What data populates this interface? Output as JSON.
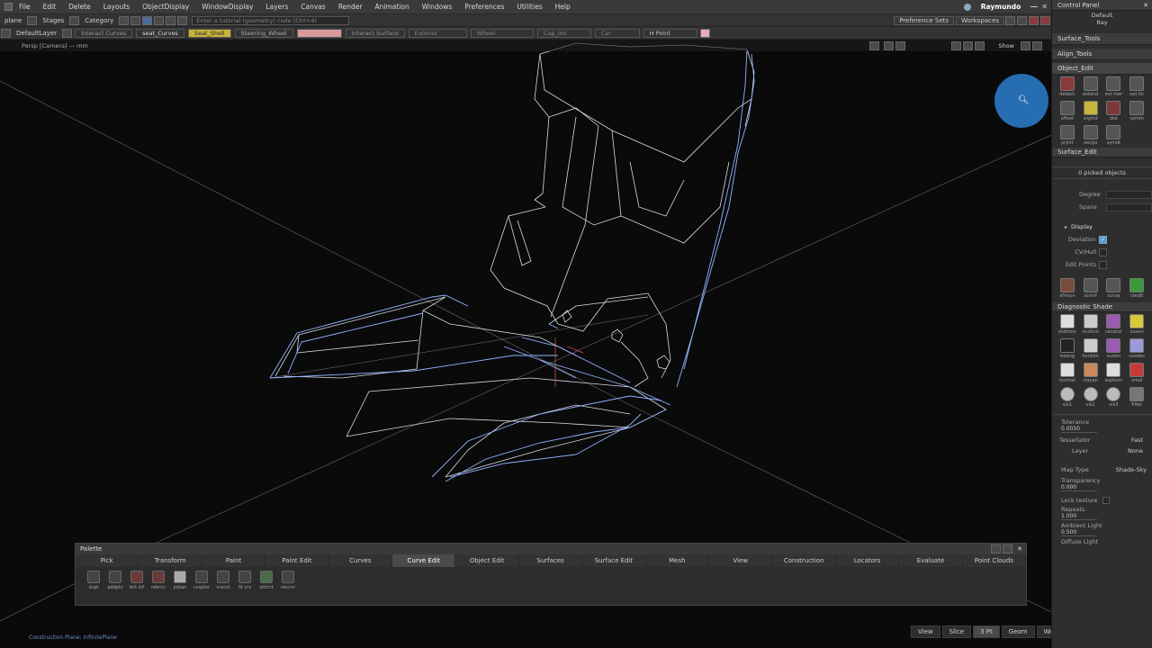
{
  "menubar": {
    "items": [
      "File",
      "Edit",
      "Delete",
      "Layouts",
      "ObjectDisplay",
      "WindowDisplay",
      "Layers",
      "Canvas",
      "Render",
      "Animation",
      "Windows",
      "Preferences",
      "Utilities",
      "Help"
    ],
    "user": "Raymundo"
  },
  "toolbar1": {
    "plane_label": "plane",
    "stages": "Stages",
    "category": "Category",
    "search_placeholder": "Enter a tutorial (geometry) code (Ctrl+4)",
    "preference_sets": "Preference Sets",
    "workspaces": "Workspaces"
  },
  "toolbar2": {
    "default_layer": "DefaultLayer",
    "tags": [
      "Interact Curves",
      "seat_Curves",
      "Seat_Shell",
      "Steering_Wheel",
      "Interact Surface",
      "Exterior",
      "Wheel",
      "Cap_ion",
      "Car"
    ],
    "hpoint": "H Point"
  },
  "viewport": {
    "camera_label": "Persp [Camera] — mm",
    "show_label": "Show",
    "construction_plane": "Construction Plane: InfinitePlane"
  },
  "panel": {
    "title": "Control Panel",
    "preset": "Default",
    "mode": "Ray",
    "tabs": [
      "Surface_Tools",
      "Align_Tools",
      "Object_Edit"
    ],
    "object_edit_tools": [
      "detach",
      "extend",
      "ext mer",
      "ext lin",
      "offset",
      "srgrnd",
      "dist",
      "symm",
      "prjrst",
      "rev/ps",
      "symdt"
    ],
    "surface_edit": "Surface_Edit",
    "picked": "0 picked objects",
    "degree_label": "Degree",
    "spans_label": "Spans",
    "display_label": "Display",
    "deviation_label": "Deviation",
    "cvhull_label": "CV/Hull",
    "editpoints_label": "Edit Points",
    "display_tools": [
      "sfrmcv",
      "scrnrf",
      "curva",
      "ctedit"
    ],
    "diagnostic": "Diagnostic Shade",
    "diag_tools": [
      "shdmon",
      "multcol",
      "randcol",
      "curevl",
      "isoang",
      "horizon",
      "surevl",
      "usedes",
      "hormal",
      "clayan",
      "sophom",
      "vmol",
      "vis1",
      "vis2",
      "vis3",
      "filter"
    ],
    "tolerance_label": "Tolerance",
    "tolerance_value": "0.0050",
    "tessellator_label": "Tessellator",
    "tessellator_value": "Fast",
    "layer_label": "Layer",
    "layer_value": "None",
    "maptype_label": "Map Type",
    "maptype_value": "Shade-Sky",
    "transparency_label": "Transparency",
    "transparency_value": "0.000",
    "locktex_label": "Lock texture",
    "repeats_label": "Repeats",
    "repeats_value": "1.000",
    "ambient_label": "Ambient Light",
    "ambient_value": "0.500",
    "diffuse_label": "Diffuse Light"
  },
  "palette": {
    "title": "Palette",
    "tabs": [
      "Pick",
      "Transform",
      "Paint",
      "Paint Edit",
      "Curves",
      "Curve Edit",
      "Object Edit",
      "Surfaces",
      "Surface Edit",
      "Mesh",
      "View",
      "Construction",
      "Locators",
      "Evaluate",
      "Point Clouds"
    ],
    "active_tab": "Curve Edit",
    "tools": [
      "dupl",
      "addpts",
      "brk inf",
      "rebrcv",
      "prjtan",
      "cvsplnr",
      "crvcst",
      "fit crv",
      "strtcrt",
      "revcrv"
    ]
  },
  "viewbuttons": [
    "View",
    "Slice",
    "3 Pt",
    "Geom",
    "World"
  ],
  "colors": {
    "wire_white": "#d9d9e6",
    "wire_blue": "#8fb4ff",
    "accent_blue": "#2d7fd0",
    "seat_shell_tag": "#c8b43a",
    "steering_tag": "#d89a9a"
  }
}
